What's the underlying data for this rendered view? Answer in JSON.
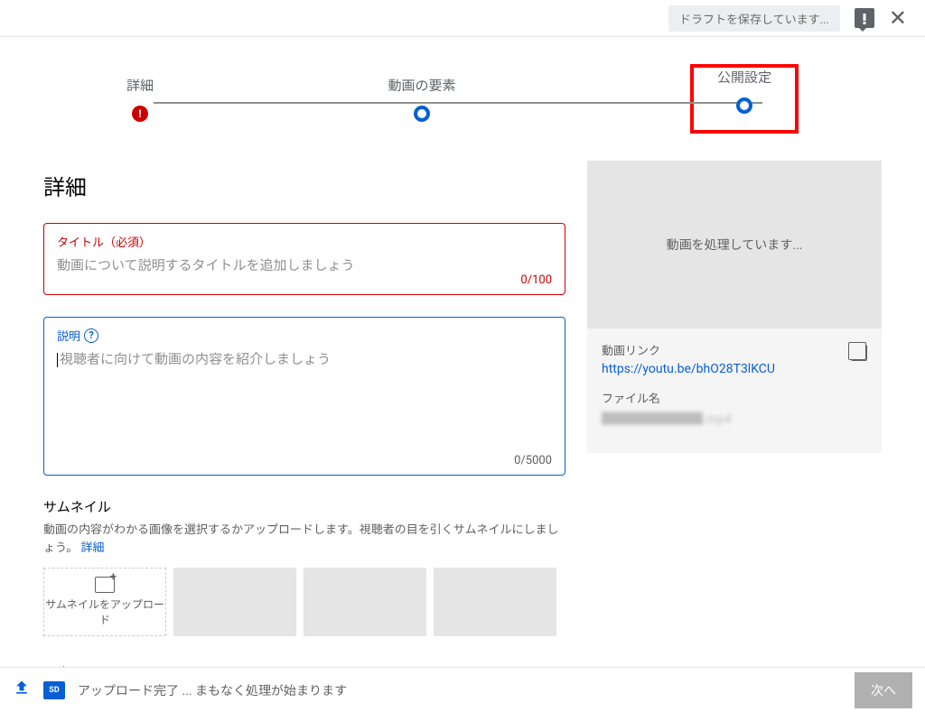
{
  "topbar": {
    "draft_status": "ドラフトを保存しています...",
    "close_glyph": "✕"
  },
  "stepper": {
    "step1": "詳細",
    "step1_error_glyph": "!",
    "step2": "動画の要素",
    "step3": "公開設定"
  },
  "main": {
    "heading": "詳細",
    "title_field": {
      "label": "タイトル（必須）",
      "placeholder": "動画について説明するタイトルを追加しましょう",
      "counter": "0/100"
    },
    "desc_field": {
      "label": "説明",
      "placeholder": "視聴者に向けて動画の内容を紹介しましょう",
      "counter": "0/5000"
    },
    "thumbnail": {
      "title": "サムネイル",
      "desc": "動画の内容がわかる画像を選択するかアップロードします。視聴者の目を引くサムネイルにしましょう。",
      "detail_link": "詳細",
      "upload_label": "サムネイルをアップロード"
    },
    "playlist_title": "再生リスト"
  },
  "preview": {
    "processing_text": "動画を処理しています...",
    "link_label": "動画リンク",
    "link_value": "https://youtu.be/bhO28T3lKCU",
    "filename_label": "ファイル名",
    "filename_value": "████████.mp4"
  },
  "footer": {
    "sd_badge": "SD",
    "status_text": "アップロード完了 ... まもなく処理が始まります",
    "next_label": "次へ"
  }
}
